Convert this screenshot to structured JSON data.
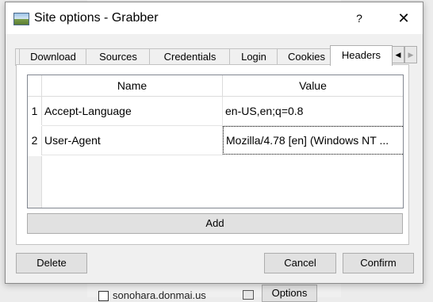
{
  "background": {
    "site_label": "sonohara.donmai.us",
    "options_label": "Options"
  },
  "window": {
    "title": "Site options - Grabber",
    "help_label": "?",
    "close_label": "✕"
  },
  "tabs": [
    {
      "label": "Download"
    },
    {
      "label": "Sources"
    },
    {
      "label": "Credentials"
    },
    {
      "label": "Login"
    },
    {
      "label": "Cookies"
    },
    {
      "label": "Headers",
      "active": true
    }
  ],
  "tab_scroll": {
    "left": "◀",
    "right": "▶"
  },
  "headers_table": {
    "columns": [
      "Name",
      "Value"
    ],
    "rows": [
      {
        "num": "1",
        "name": "Accept-Language",
        "value": "en-US,en;q=0.8"
      },
      {
        "num": "2",
        "name": "User-Agent",
        "value": "Mozilla/4.78 [en] (Windows NT ..."
      }
    ]
  },
  "buttons": {
    "add": "Add",
    "delete": "Delete",
    "cancel": "Cancel",
    "confirm": "Confirm"
  }
}
